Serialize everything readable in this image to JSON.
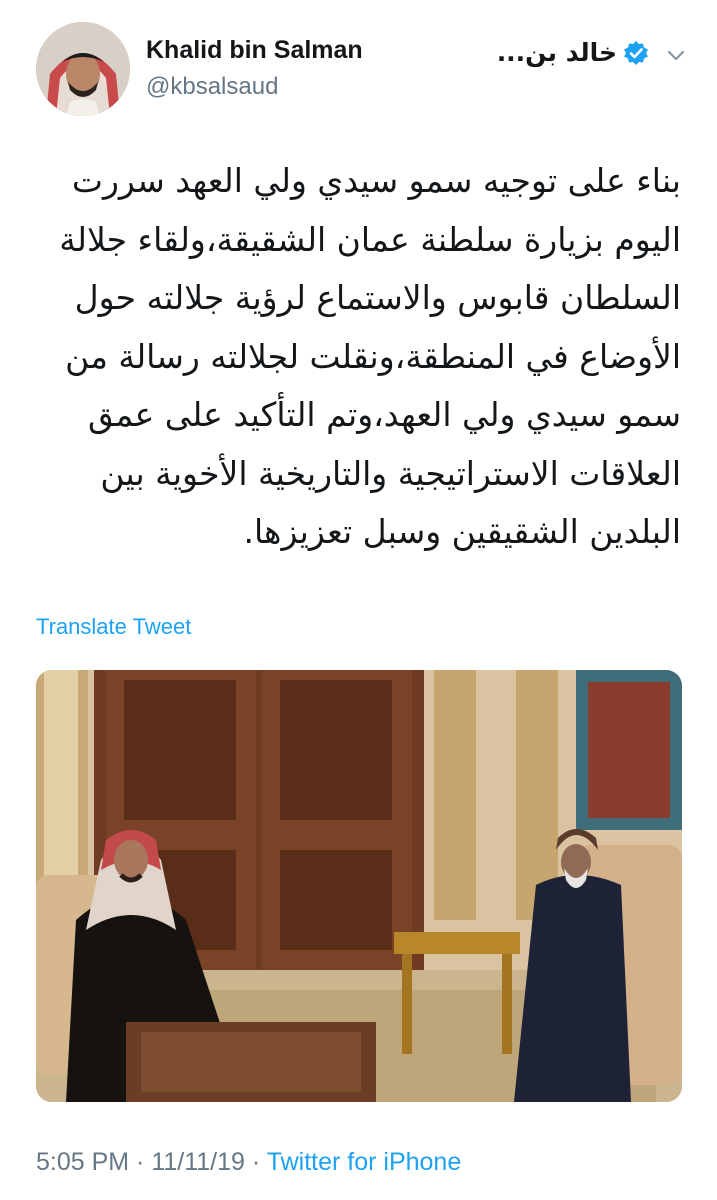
{
  "author": {
    "display_name": "Khalid bin Salman",
    "handle": "@kbsalsaud",
    "arabic_display_name": "خالد بن..."
  },
  "tweet": {
    "lines": [
      "بناء على توجيه سمو سيدي ولي العهد سررت",
      "اليوم بزيارة سلطنة عمان الشقيقة،ولقاء جلالة",
      "السلطان قابوس والاستماع لرؤية جلالته حول",
      "الأوضاع في المنطقة،ونقلت لجلالته رسالة من",
      "سمو سيدي ولي العهد،وتم التأكيد على عمق",
      "العلاقات الاستراتيجية والتاريخية الأخوية بين",
      "البلدين الشقيقين وسبل تعزيزها."
    ],
    "translate_label": "Translate Tweet"
  },
  "meta": {
    "time": "5:05 PM",
    "separator1": " · ",
    "date": "11/11/19",
    "separator2": " · ",
    "source": "Twitter for iPhone"
  },
  "icons": {
    "verified": "verified-badge-icon",
    "more": "chevron-down-icon"
  },
  "colors": {
    "link": "#1da1f2",
    "secondary_text": "#657786",
    "primary_text": "#14171a"
  }
}
